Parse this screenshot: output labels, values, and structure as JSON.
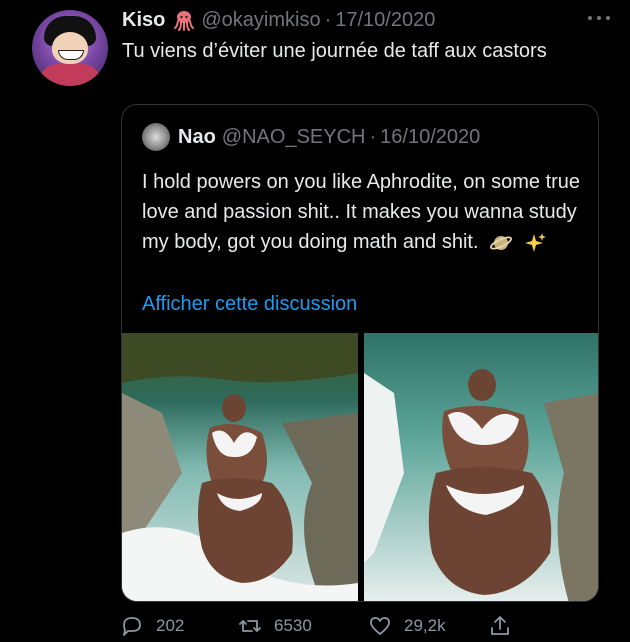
{
  "tweet": {
    "author_name": "Kiso",
    "author_handle": "@okayimkiso",
    "separator": "·",
    "date": "17/10/2020",
    "text": "Tu viens d’éviter une journée de taff aux castors",
    "icons": {
      "author_badge": "octopus-icon",
      "more": "more-icon"
    }
  },
  "quote": {
    "author_name": "Nao",
    "author_handle": "@NAO_SEYCH",
    "separator": "·",
    "date": "16/10/2020",
    "text": "I hold powers on you like Aphrodite, on some true love and passion shit.. It makes you wanna study my body, got you doing math and shit.",
    "emojis": [
      "planet-emoji",
      "sparkles-emoji"
    ],
    "show_thread_label": "Afficher cette discussion"
  },
  "actions": {
    "replies": "202",
    "retweets": "6530",
    "likes": "29,2k"
  },
  "colors": {
    "background": "#000000",
    "text": "#e7e9ea",
    "muted": "#71767b",
    "link": "#1d9bf0",
    "border": "#2f3336"
  }
}
